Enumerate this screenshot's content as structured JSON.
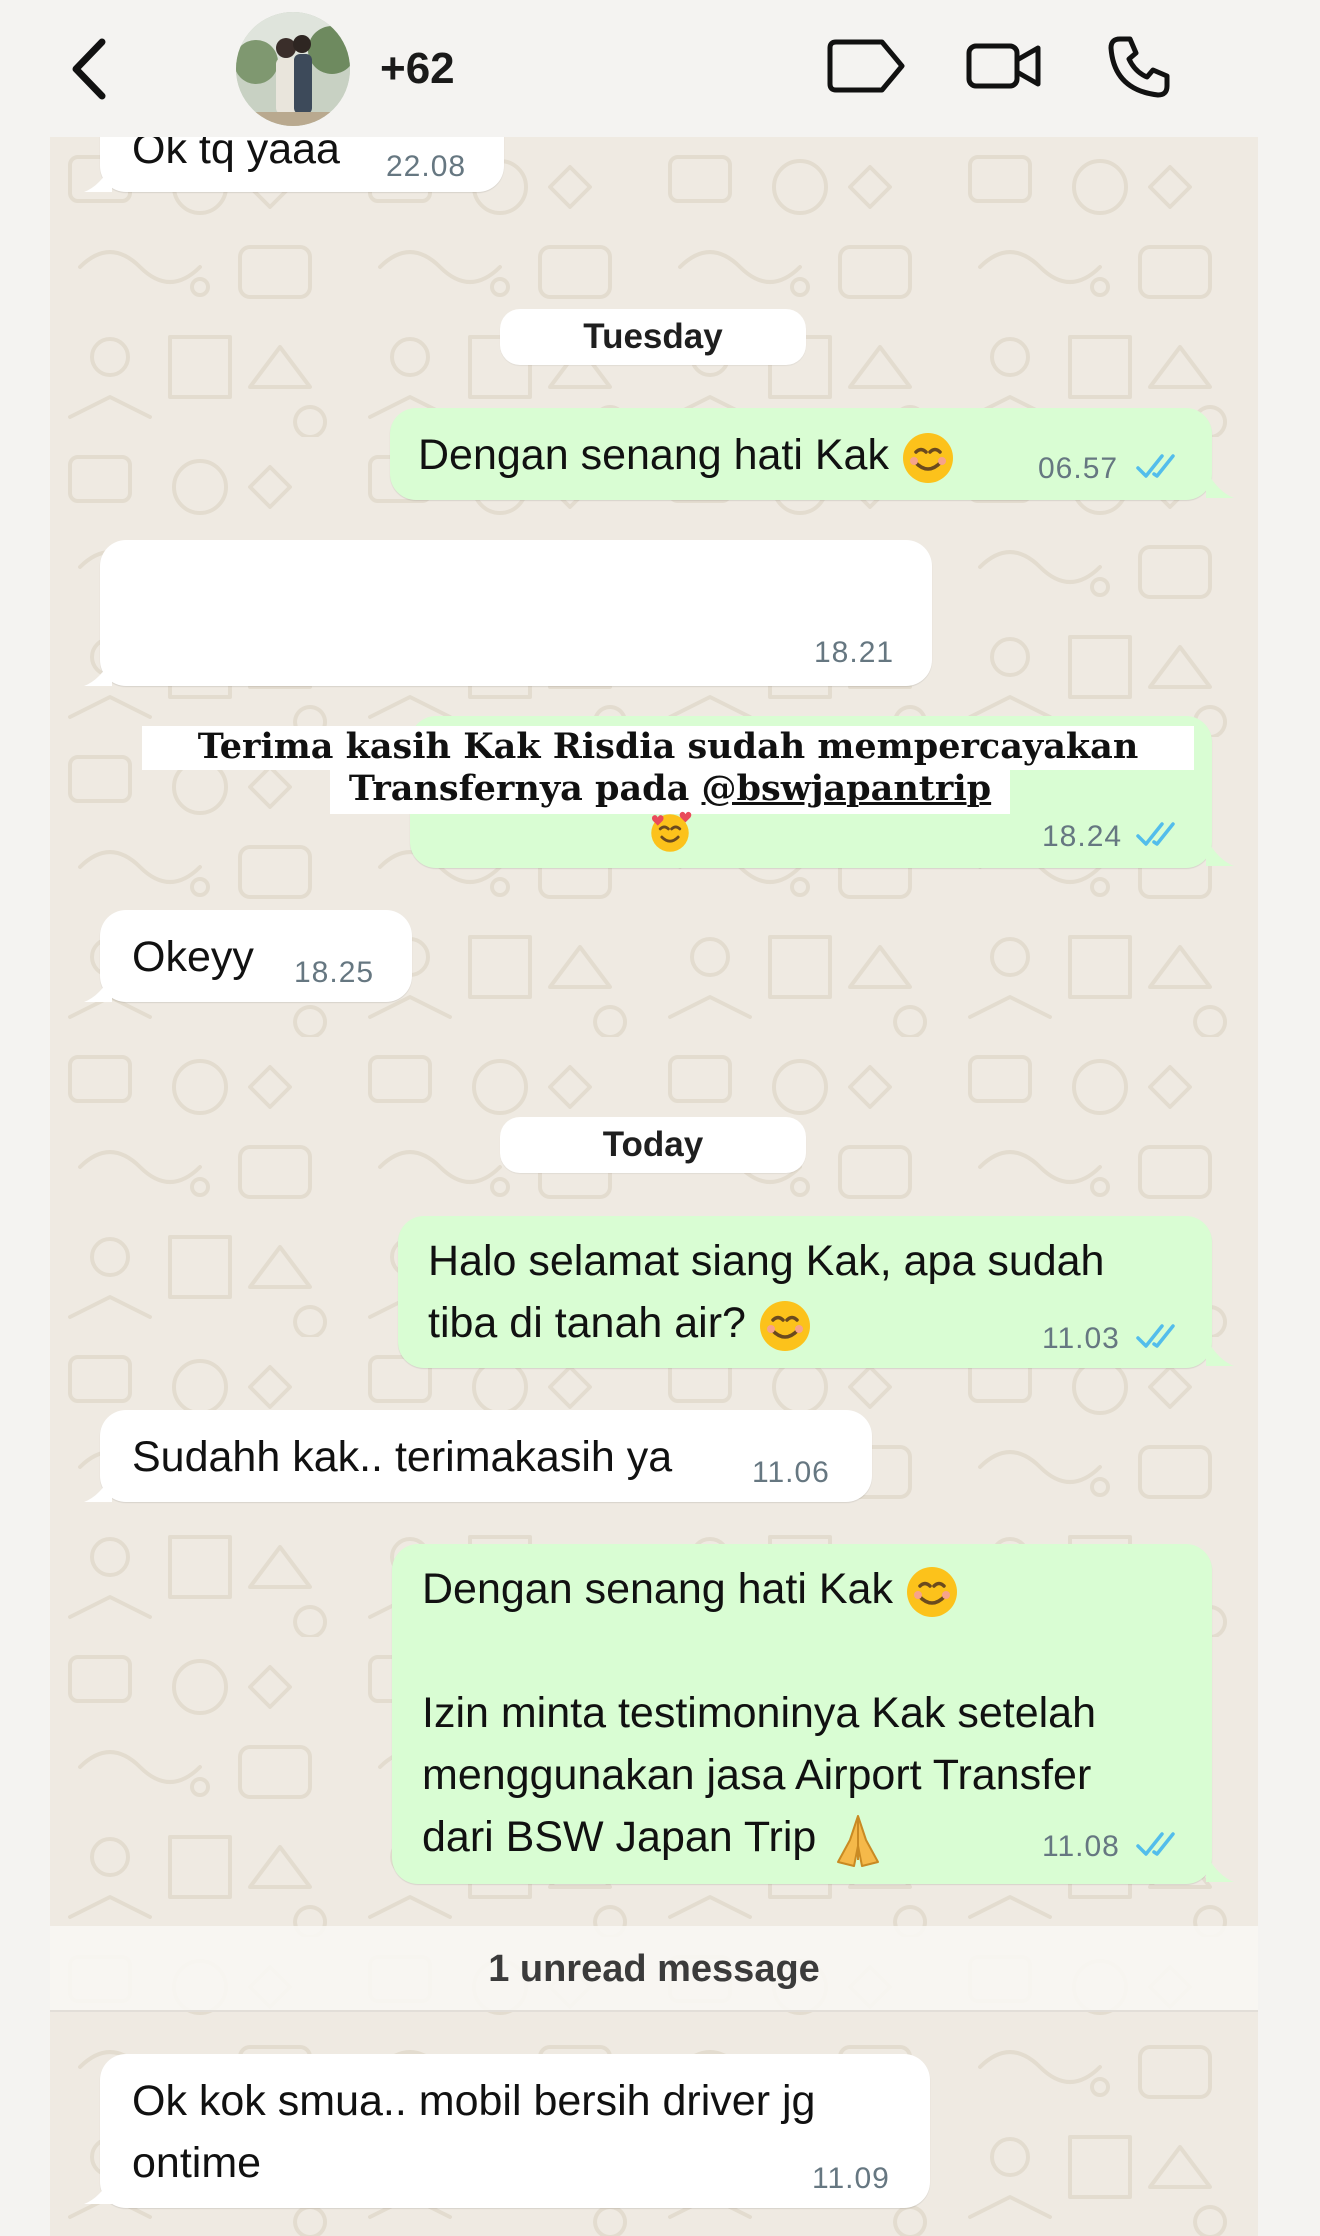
{
  "header": {
    "contact_name": "+62",
    "back_icon": "chevron-left-icon",
    "label_icon": "label-tag-icon",
    "video_icon": "video-camera-icon",
    "call_icon": "phone-icon"
  },
  "colors": {
    "incoming_bubble": "#ffffff",
    "outgoing_bubble": "#d9fdd3",
    "read_ticks": "#53bdeb",
    "wallpaper": "#efeae2"
  },
  "messages": {
    "m1": {
      "text": "Ok tq yaaa",
      "time": "22.08",
      "direction": "incoming"
    },
    "m2": {
      "text": "Dengan senang hati Kak",
      "emoji": "smiling-face-emoji",
      "time": "06.57",
      "direction": "outgoing",
      "status": "read"
    },
    "m3": {
      "text": "",
      "time": "18.21",
      "direction": "incoming"
    },
    "m4": {
      "caption_line1": "Terima kasih Kak Risdia sudah mempercayakan Airport",
      "caption_line2": "Transfernya pada",
      "caption_handle": "@bswjapantrip",
      "emoji": "smiling-face-with-hearts-emoji",
      "time": "18.24",
      "direction": "outgoing",
      "status": "read"
    },
    "m5": {
      "text": "Okeyy",
      "time": "18.25",
      "direction": "incoming"
    },
    "m6": {
      "line1": "Halo selamat siang Kak, apa sudah",
      "line2": "tiba di tanah air?",
      "emoji": "smiling-face-emoji",
      "time": "11.03",
      "direction": "outgoing",
      "status": "read"
    },
    "m7": {
      "text": "Sudahh kak.. terimakasih ya",
      "time": "11.06",
      "direction": "incoming"
    },
    "m8": {
      "line1": "Dengan senang hati Kak",
      "line2": "Izin minta testimoninya Kak setelah",
      "line3": "menggunakan jasa Airport Transfer",
      "line4": "dari BSW Japan Trip",
      "emoji1": "smiling-face-emoji",
      "emoji2": "folded-hands-emoji",
      "time": "11.08",
      "direction": "outgoing",
      "status": "read"
    },
    "m9": {
      "line1": "Ok kok smua.. mobil bersih driver jg",
      "line2": "ontime",
      "time": "11.09",
      "direction": "incoming"
    }
  },
  "day_labels": {
    "tuesday": "Tuesday",
    "today": "Today"
  },
  "unread_label": "1 unread message"
}
